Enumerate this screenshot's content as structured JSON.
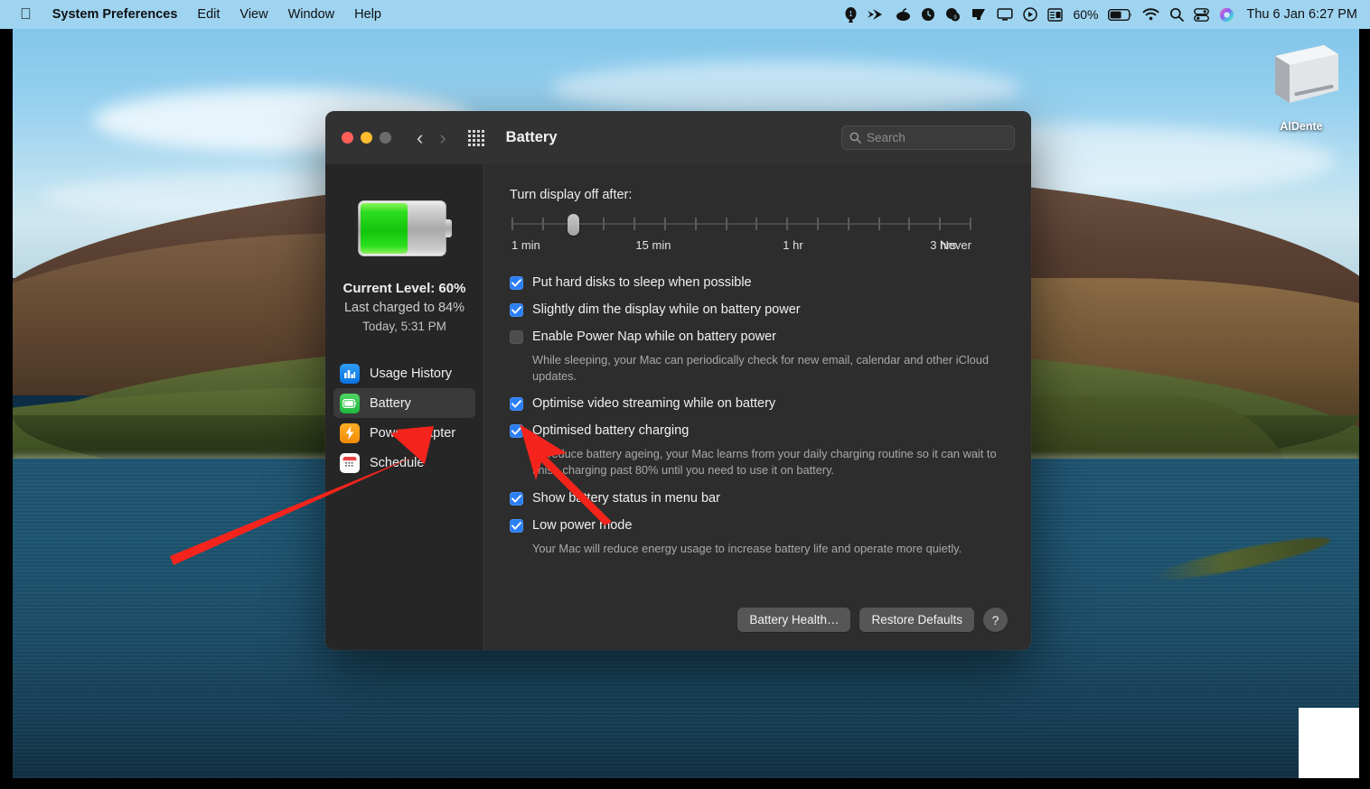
{
  "menubar": {
    "apple_icon": "apple-logo-icon",
    "items": [
      {
        "label": "System Preferences",
        "bold": true
      },
      {
        "label": "Edit",
        "bold": false
      },
      {
        "label": "View",
        "bold": false
      },
      {
        "label": "Window",
        "bold": false
      },
      {
        "label": "Help",
        "bold": false
      }
    ],
    "status_icons": [
      "onepassword-icon",
      "forward-arrows-icon",
      "coconut-battery-icon",
      "refresh-circle-icon",
      "bartender-icon",
      "display-tilt-icon",
      "screen-icon",
      "play-circle-icon",
      "news-reader-icon"
    ],
    "battery_percent": "60%",
    "battery_icon": "battery-status-icon",
    "wifi_icon": "wifi-icon",
    "search_icon": "spotlight-search-icon",
    "control_center_icon": "control-center-icon",
    "siri_icon": "siri-icon",
    "clock": "Thu 6 Jan  6:27 PM"
  },
  "desktop": {
    "icon_label": "AlDente",
    "icon_name": "disk-drive-icon"
  },
  "window": {
    "title": "Battery",
    "traffic_lights": [
      "close",
      "minimise",
      "zoom"
    ],
    "back_icon": "chevron-left-icon",
    "forward_icon": "chevron-right-icon",
    "grid_icon": "show-all-grid-icon",
    "search": {
      "placeholder": "Search",
      "value": "",
      "icon": "magnifier-icon"
    }
  },
  "sidebar": {
    "battery_fill_percent": 58,
    "current_level": "Current Level: 60%",
    "last_charged": "Last charged to 84%",
    "last_charged_time": "Today, 5:31 PM",
    "items": [
      {
        "label": "Usage History",
        "icon": "bar-chart-icon",
        "selected": false
      },
      {
        "label": "Battery",
        "icon": "battery-icon",
        "selected": true
      },
      {
        "label": "Power Adapter",
        "icon": "lightning-bolt-icon",
        "selected": false
      },
      {
        "label": "Schedule",
        "icon": "calendar-icon",
        "selected": false
      }
    ]
  },
  "content": {
    "slider_label": "Turn display off after:",
    "slider": {
      "ticks": 16,
      "value_index": 2,
      "labels": [
        {
          "text": "1 min",
          "pos_pct": 0
        },
        {
          "text": "15 min",
          "pos_pct": 27
        },
        {
          "text": "1 hr",
          "pos_pct": 59
        },
        {
          "text": "3 hrs",
          "pos_pct": 91
        },
        {
          "text": "Never",
          "pos_pct": 100
        }
      ]
    },
    "options": [
      {
        "label": "Put hard disks to sleep when possible",
        "checked": true,
        "description": ""
      },
      {
        "label": "Slightly dim the display while on battery power",
        "checked": true,
        "description": ""
      },
      {
        "label": "Enable Power Nap while on battery power",
        "checked": false,
        "description": "While sleeping, your Mac can periodically check for new email, calendar and other iCloud updates."
      },
      {
        "label": "Optimise video streaming while on battery",
        "checked": true,
        "description": ""
      },
      {
        "label": "Optimised battery charging",
        "checked": true,
        "description": "To reduce battery ageing, your Mac learns from your daily charging routine so it can wait to finish charging past 80% until you need to use it on battery."
      },
      {
        "label": "Show battery status in menu bar",
        "checked": true,
        "description": ""
      },
      {
        "label": "Low power mode",
        "checked": true,
        "description": "Your Mac will reduce energy usage to increase battery life and operate more quietly."
      }
    ],
    "buttons": [
      {
        "label": "Battery Health…",
        "name": "battery-health-button"
      },
      {
        "label": "Restore Defaults",
        "name": "restore-defaults-button"
      },
      {
        "label": "?",
        "name": "help-button"
      }
    ]
  },
  "annotations": {
    "arrow_color": "#f4241c",
    "arrow_1_target": "sidebar-item-battery",
    "arrow_2_target": "optimised-battery-charging-checkbox"
  }
}
